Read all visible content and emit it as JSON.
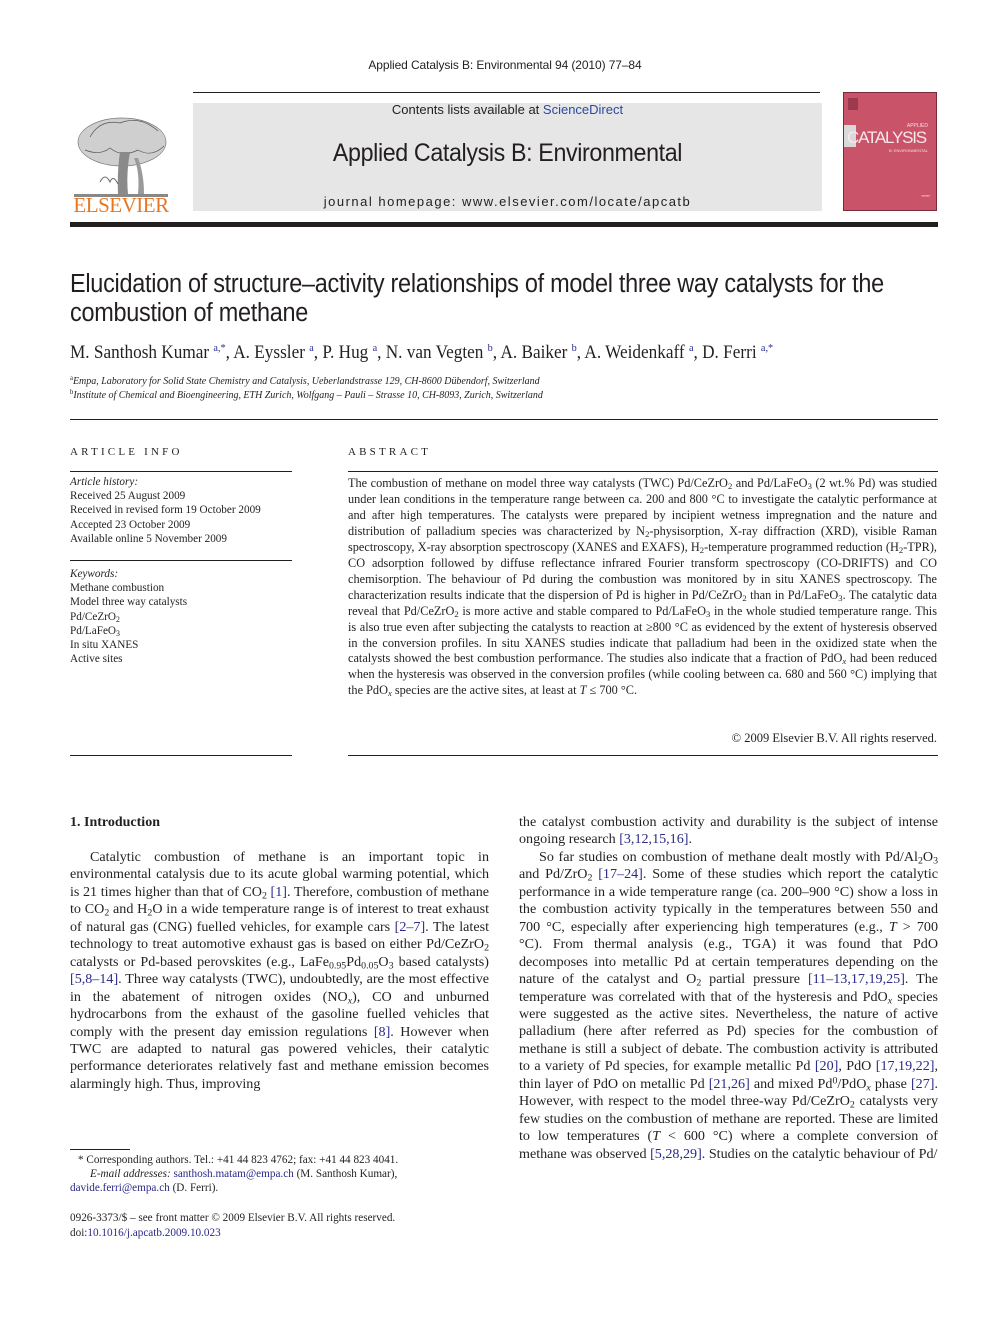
{
  "header": {
    "running_head": "Applied Catalysis B: Environmental 94 (2010) 77–84",
    "contents_prefix": "Contents lists available at ",
    "contents_link": "ScienceDirect",
    "journal_name": "Applied Catalysis B: Environmental",
    "homepage": "journal homepage: www.elsevier.com/locate/apcatb",
    "publisher_logo_text": "ELSEVIER",
    "cover": {
      "applied": "APPLIED",
      "title": "CATALYSIS",
      "subtitle": "B: ENVIRONMENTAL",
      "color": "#c9546a"
    },
    "logo_color": "#e87722",
    "link_color": "#2a2a8a"
  },
  "article": {
    "title": "Elucidation of structure–activity relationships of model three way catalysts for the combustion of methane",
    "authors": [
      {
        "name": "M. Santhosh Kumar",
        "aff": "a,*"
      },
      {
        "name": "A. Eyssler",
        "aff": "a"
      },
      {
        "name": "P. Hug",
        "aff": "a"
      },
      {
        "name": "N. van Vegten",
        "aff": "b"
      },
      {
        "name": "A. Baiker",
        "aff": "b"
      },
      {
        "name": "A. Weidenkaff",
        "aff": "a"
      },
      {
        "name": "D. Ferri",
        "aff": "a,*"
      }
    ],
    "affiliations": [
      {
        "key": "a",
        "text": "Empa, Laboratory for Solid State Chemistry and Catalysis, Ueberlandstrasse 129, CH-8600 Dübendorf, Switzerland"
      },
      {
        "key": "b",
        "text": "Institute of Chemical and Bioengineering, ETH Zurich, Wolfgang – Pauli – Strasse 10, CH-8093, Zurich, Switzerland"
      }
    ]
  },
  "article_info": {
    "heading": "ARTICLE INFO",
    "history_label": "Article history:",
    "history": [
      "Received 25 August 2009",
      "Received in revised form 19 October 2009",
      "Accepted 23 October 2009",
      "Available online 5 November 2009"
    ],
    "keywords_label": "Keywords:",
    "keywords": [
      "Methane combustion",
      "Model three way catalysts",
      "Pd/CeZrO2",
      "Pd/LaFeO3",
      "In situ XANES",
      "Active sites"
    ]
  },
  "abstract": {
    "heading": "ABSTRACT",
    "text": "The combustion of methane on model three way catalysts (TWC) Pd/CeZrO2 and Pd/LaFeO3 (2 wt.% Pd) was studied under lean conditions in the temperature range between ca. 200 and 800 °C to investigate the catalytic performance at and after high temperatures. The catalysts were prepared by incipient wetness impregnation and the nature and distribution of palladium species was characterized by N2-physisorption, X-ray diffraction (XRD), visible Raman spectroscopy, X-ray absorption spectroscopy (XANES and EXAFS), H2-temperature programmed reduction (H2-TPR), CO adsorption followed by diffuse reflectance infrared Fourier transform spectroscopy (CO-DRIFTS) and CO chemisorption. The behaviour of Pd during the combustion was monitored by in situ XANES spectroscopy. The characterization results indicate that the dispersion of Pd is higher in Pd/CeZrO2 than in Pd/LaFeO3. The catalytic data reveal that Pd/CeZrO2 is more active and stable compared to Pd/LaFeO3 in the whole studied temperature range. This is also true even after subjecting the catalysts to reaction at ≥800 °C as evidenced by the extent of hysteresis observed in the conversion profiles. In situ XANES studies indicate that palladium had been in the oxidized state when the catalysts showed the best combustion performance. The studies also indicate that a fraction of PdOx had been reduced when the hysteresis was observed in the conversion profiles (while cooling between ca. 680 and 560 °C) implying that the PdOx species are the active sites, at least at T ≤ 700 °C.",
    "copyright": "© 2009 Elsevier B.V. All rights reserved."
  },
  "body": {
    "section_heading": "1. Introduction",
    "left_paragraph": "Catalytic combustion of methane is an important topic in environmental catalysis due to its acute global warming potential, which is 21 times higher than that of CO2 [1]. Therefore, combustion of methane to CO2 and H2O in a wide temperature range is of interest to treat exhaust of natural gas (CNG) fuelled vehicles, for example cars [2–7]. The latest technology to treat automotive exhaust gas is based on either Pd/CeZrO2 catalysts or Pd-based perovskites (e.g., LaFe0.95Pd0.05O3 based catalysts) [5,8–14]. Three way catalysts (TWC), undoubtedly, are the most effective in the abatement of nitrogen oxides (NOx), CO and unburned hydrocarbons from the exhaust of the gasoline fuelled vehicles that comply with the present day emission regulations [8]. However when TWC are adapted to natural gas powered vehicles, their catalytic performance deteriorates relatively fast and methane emission becomes alarmingly high. Thus, improving",
    "right_paragraph_1": "the catalyst combustion activity and durability is the subject of intense ongoing research [3,12,15,16].",
    "right_paragraph_2": "So far studies on combustion of methane dealt mostly with Pd/Al2O3 and Pd/ZrO2 [17–24]. Some of these studies which report the catalytic performance in a wide temperature range (ca. 200–900 °C) show a loss in the combustion activity typically in the temperatures between 550 and 700 °C, especially after experiencing high temperatures (e.g., T > 700 °C). From thermal analysis (e.g., TGA) it was found that PdO decomposes into metallic Pd at certain temperatures depending on the nature of the catalyst and O2 partial pressure [11–13,17,19,25]. The temperature was correlated with that of the hysteresis and PdOx species were suggested as the active sites. Nevertheless, the nature of active palladium (here after referred as Pd) species for the combustion of methane is still a subject of debate. The combustion activity is attributed to a variety of Pd species, for example metallic Pd [20], PdO [17,19,22], thin layer of PdO on metallic Pd [21,26] and mixed Pd0/PdOx phase [27]. However, with respect to the model three-way Pd/CeZrO2 catalysts very few studies on the combustion of methane are reported. These are limited to low temperatures (T < 600 °C) where a complete conversion of methane was observed [5,28,29]. Studies on the catalytic behaviour of Pd/"
  },
  "footnote": {
    "corresponding": "* Corresponding authors. Tel.: +41 44 823 4762; fax: +41 44 823 4041.",
    "email_label": "E-mail addresses:",
    "email_1": "santhosh.matam@empa.ch",
    "email_1_owner": " (M. Santhosh Kumar),",
    "email_2": "davide.ferri@empa.ch",
    "email_2_owner": " (D. Ferri).",
    "front_matter": "0926-3373/$ – see front matter © 2009 Elsevier B.V. All rights reserved.",
    "doi_prefix": "doi:",
    "doi": "10.1016/j.apcatb.2009.10.023"
  }
}
